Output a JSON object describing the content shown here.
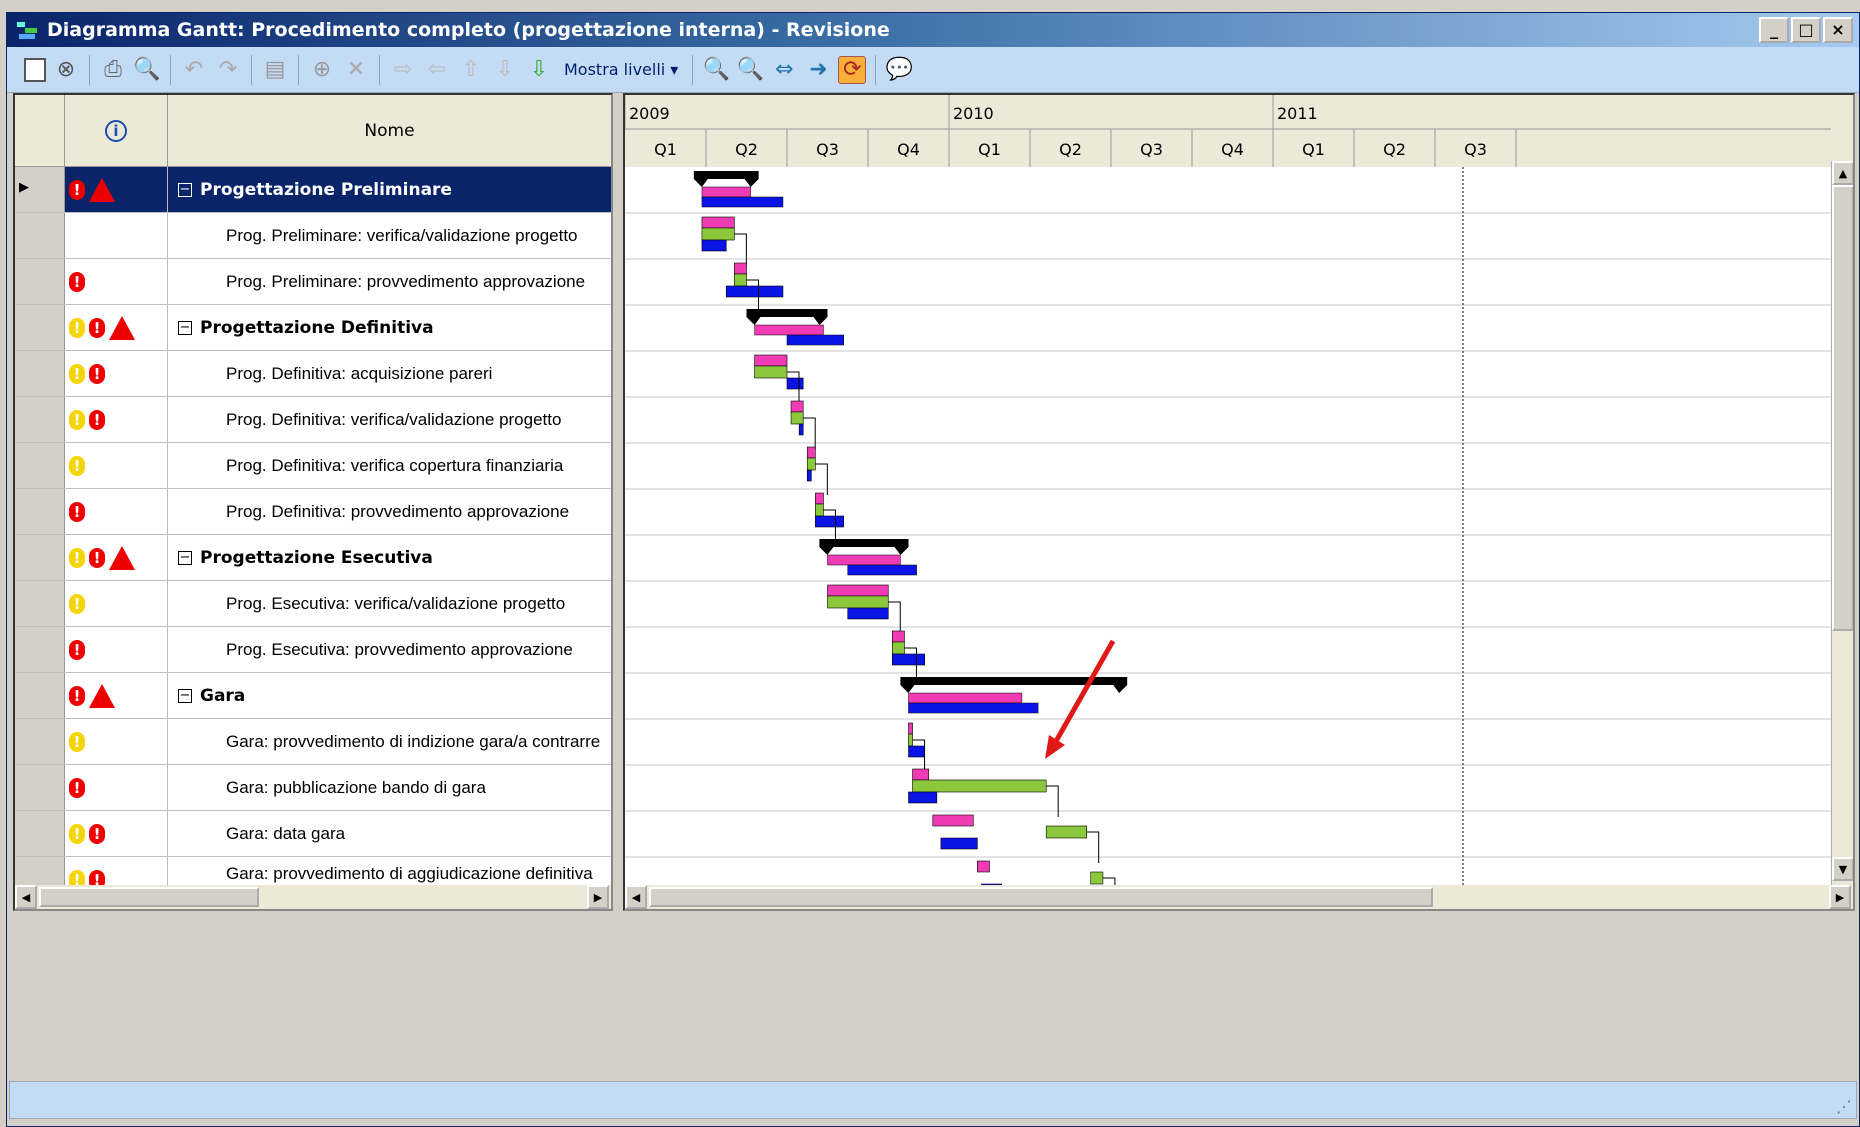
{
  "window": {
    "title": "Diagramma Gantt: Procedimento completo (progettazione interna) - Revisione",
    "buttons": {
      "minimize": "_",
      "maximize": "□",
      "close": "×"
    }
  },
  "toolbar": {
    "levels_label": "Mostra livelli ▾",
    "icons": [
      "save-icon",
      "cancel-icon",
      "print-icon",
      "print-preview-icon",
      "undo-icon",
      "redo-icon",
      "page-icon",
      "add-icon",
      "delete-icon",
      "indent-icon",
      "outdent-icon",
      "move-up-icon",
      "move-down-icon",
      "insert-below-icon",
      "zoom-in-icon",
      "zoom-out-icon",
      "fit-icon",
      "link-icon",
      "refresh-icon",
      "comment-icon"
    ]
  },
  "grid": {
    "header": {
      "info_icon": "i",
      "name": "Nome"
    },
    "rows": [
      {
        "name": "Progettazione Preliminare",
        "summary": true,
        "icons": [
          "red",
          "tri"
        ],
        "selected": true
      },
      {
        "name": "Prog. Preliminare: verifica/validazione progetto",
        "summary": false,
        "icons": []
      },
      {
        "name": "Prog. Preliminare: provvedimento approvazione",
        "summary": false,
        "icons": [
          "red"
        ]
      },
      {
        "name": "Progettazione Definitiva",
        "summary": true,
        "icons": [
          "yel",
          "red",
          "tri"
        ]
      },
      {
        "name": "Prog. Definitiva: acquisizione pareri",
        "summary": false,
        "icons": [
          "yel",
          "red"
        ]
      },
      {
        "name": "Prog. Definitiva: verifica/validazione progetto",
        "summary": false,
        "icons": [
          "yel",
          "red"
        ]
      },
      {
        "name": "Prog. Definitiva: verifica copertura finanziaria",
        "summary": false,
        "icons": [
          "yel"
        ]
      },
      {
        "name": "Prog. Definitiva: provvedimento approvazione",
        "summary": false,
        "icons": [
          "red"
        ]
      },
      {
        "name": "Progettazione Esecutiva",
        "summary": true,
        "icons": [
          "yel",
          "red",
          "tri"
        ]
      },
      {
        "name": "Prog. Esecutiva: verifica/validazione progetto",
        "summary": false,
        "icons": [
          "yel"
        ]
      },
      {
        "name": "Prog. Esecutiva: provvedimento approvazione",
        "summary": false,
        "icons": [
          "red"
        ]
      },
      {
        "name": "Gara",
        "summary": true,
        "icons": [
          "red",
          "tri"
        ]
      },
      {
        "name": "Gara: provvedimento di indizione gara/a contrarre",
        "summary": false,
        "icons": [
          "yel"
        ]
      },
      {
        "name": "Gara: pubblicazione bando di gara",
        "summary": false,
        "icons": [
          "red"
        ]
      },
      {
        "name": "Gara: data gara",
        "summary": false,
        "icons": [
          "yel",
          "red"
        ]
      },
      {
        "name": "Gara: provvedimento di aggiudicazione definitiva con efficacia",
        "summary": false,
        "icons": [
          "yel",
          "red"
        ]
      }
    ]
  },
  "timeline": {
    "years": [
      "2009",
      "2010",
      "2011"
    ],
    "quarters": [
      "Q1",
      "Q2",
      "Q3",
      "Q4",
      "Q1",
      "Q2",
      "Q3",
      "Q4",
      "Q1",
      "Q2",
      "Q3"
    ]
  },
  "gantt_bars": [
    {
      "row": 0,
      "summary": [
        0.85,
        1.65
      ],
      "pink": [
        0.95,
        1.55
      ],
      "green": null,
      "blue": [
        0.95,
        1.95
      ]
    },
    {
      "row": 1,
      "pink": [
        0.95,
        1.35
      ],
      "green": [
        0.95,
        1.35
      ],
      "blue": [
        0.95,
        1.25
      ]
    },
    {
      "row": 2,
      "pink": [
        1.35,
        1.5
      ],
      "green": [
        1.35,
        1.5
      ],
      "blue": [
        1.25,
        1.95
      ]
    },
    {
      "row": 3,
      "summary": [
        1.5,
        2.5
      ],
      "pink": [
        1.6,
        2.45
      ],
      "green": null,
      "blue": [
        2.0,
        2.7
      ]
    },
    {
      "row": 4,
      "pink": [
        1.6,
        2.0
      ],
      "green": [
        1.6,
        2.0
      ],
      "blue": [
        2.0,
        2.2
      ]
    },
    {
      "row": 5,
      "pink": [
        2.05,
        2.2
      ],
      "green": [
        2.05,
        2.2
      ],
      "blue": [
        2.15,
        2.2
      ]
    },
    {
      "row": 6,
      "pink": [
        2.25,
        2.35
      ],
      "green": [
        2.25,
        2.35
      ],
      "blue": [
        2.25,
        2.3
      ]
    },
    {
      "row": 7,
      "pink": [
        2.35,
        2.45
      ],
      "green": [
        2.35,
        2.45
      ],
      "blue": [
        2.35,
        2.7
      ]
    },
    {
      "row": 8,
      "summary": [
        2.4,
        3.5
      ],
      "pink": [
        2.5,
        3.4
      ],
      "green": null,
      "blue": [
        2.75,
        3.6
      ]
    },
    {
      "row": 9,
      "pink": [
        2.5,
        3.25
      ],
      "green": [
        2.5,
        3.25
      ],
      "blue": [
        2.75,
        3.25
      ]
    },
    {
      "row": 10,
      "pink": [
        3.3,
        3.45
      ],
      "green": [
        3.3,
        3.45
      ],
      "blue": [
        3.3,
        3.7
      ]
    },
    {
      "row": 11,
      "summary": [
        3.4,
        6.2
      ],
      "pink": [
        3.5,
        4.9
      ],
      "green": null,
      "blue": [
        3.5,
        5.1
      ]
    },
    {
      "row": 12,
      "pink": [
        3.5,
        3.55
      ],
      "green": [
        3.5,
        3.55
      ],
      "blue": [
        3.5,
        3.7
      ]
    },
    {
      "row": 13,
      "pink": [
        3.55,
        3.75
      ],
      "green": [
        3.55,
        5.2
      ],
      "blue": [
        3.5,
        3.85
      ]
    },
    {
      "row": 14,
      "pink": [
        3.8,
        4.3
      ],
      "green": [
        5.2,
        5.7
      ],
      "blue": [
        3.9,
        4.35
      ]
    },
    {
      "row": 15,
      "pink": [
        4.35,
        4.5
      ],
      "green": [
        5.75,
        5.9
      ],
      "blue": [
        4.4,
        4.65
      ]
    }
  ]
}
